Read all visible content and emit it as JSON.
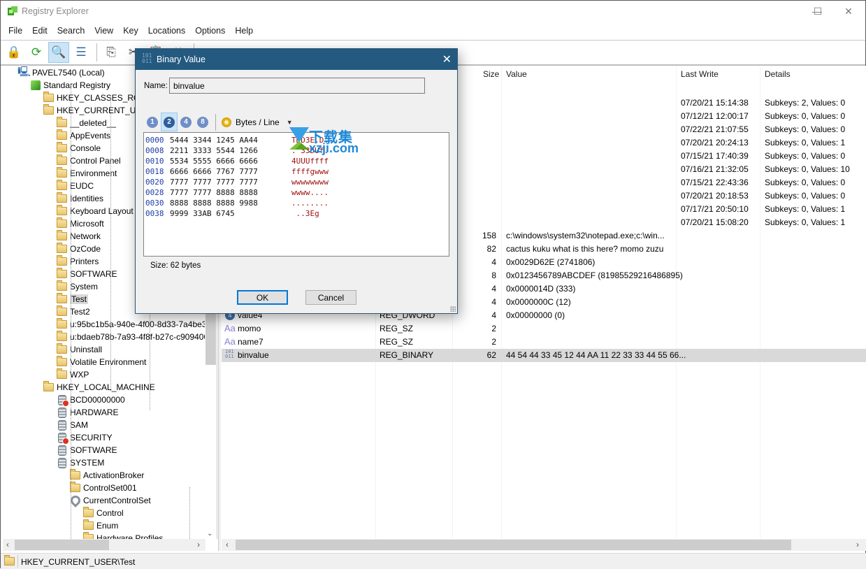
{
  "window": {
    "title": "Registry Explorer",
    "controls": {
      "minimize": "—",
      "maximize": "☐",
      "close": "✕"
    }
  },
  "menu": [
    "File",
    "Edit",
    "Search",
    "View",
    "Key",
    "Locations",
    "Options",
    "Help"
  ],
  "toolbar": {
    "buttons": [
      {
        "icon": "lock-icon",
        "glyph": "🔒"
      },
      {
        "icon": "refresh-icon",
        "glyph": "⟳"
      },
      {
        "icon": "browse-folder-icon",
        "glyph": "🔍",
        "active": true
      },
      {
        "icon": "view-list-icon",
        "glyph": "☰"
      },
      {
        "icon": "copy-icon",
        "glyph": "⎘"
      },
      {
        "icon": "cut-icon",
        "glyph": "✂"
      },
      {
        "icon": "paste-icon",
        "glyph": "📋"
      },
      {
        "icon": "delete-icon",
        "glyph": "✖"
      },
      {
        "icon": "back-icon",
        "glyph": "◀"
      },
      {
        "icon": "forward-icon",
        "glyph": "▶"
      },
      {
        "icon": "registry-icon",
        "glyph": "▦"
      }
    ]
  },
  "tree": {
    "items": [
      {
        "label": "PAVEL7540 (Local)",
        "icon": "computer",
        "level": 0
      },
      {
        "label": "Standard Registry",
        "icon": "registry",
        "level": 1
      },
      {
        "label": "HKEY_CLASSES_ROOT",
        "icon": "folder",
        "level": 2
      },
      {
        "label": "HKEY_CURRENT_USER",
        "icon": "folder",
        "level": 2
      },
      {
        "label": "__deleted__",
        "icon": "folder",
        "level": 3
      },
      {
        "label": "AppEvents",
        "icon": "folder",
        "level": 3
      },
      {
        "label": "Console",
        "icon": "folder",
        "level": 3
      },
      {
        "label": "Control Panel",
        "icon": "folder",
        "level": 3
      },
      {
        "label": "Environment",
        "icon": "folder",
        "level": 3
      },
      {
        "label": "EUDC",
        "icon": "folder",
        "level": 3
      },
      {
        "label": "Identities",
        "icon": "folder",
        "level": 3
      },
      {
        "label": "Keyboard Layout",
        "icon": "folder",
        "level": 3
      },
      {
        "label": "Microsoft",
        "icon": "folder",
        "level": 3
      },
      {
        "label": "Network",
        "icon": "folder",
        "level": 3
      },
      {
        "label": "OzCode",
        "icon": "folder",
        "level": 3
      },
      {
        "label": "Printers",
        "icon": "folder",
        "level": 3
      },
      {
        "label": "SOFTWARE",
        "icon": "folder",
        "level": 3
      },
      {
        "label": "System",
        "icon": "folder",
        "level": 3
      },
      {
        "label": "Test",
        "icon": "folder-open",
        "level": 3,
        "selected": true
      },
      {
        "label": "Test2",
        "icon": "folder",
        "level": 3
      },
      {
        "label": "u:95bc1b5a-940e-4f00-8d33-7a4be3",
        "icon": "folder",
        "level": 3
      },
      {
        "label": "u:bdaeb78b-7a93-4f8f-b27c-c909400",
        "icon": "folder",
        "level": 3
      },
      {
        "label": "Uninstall",
        "icon": "folder",
        "level": 3
      },
      {
        "label": "Volatile Environment",
        "icon": "folder",
        "level": 3
      },
      {
        "label": "WXP",
        "icon": "folder",
        "level": 3
      },
      {
        "label": "HKEY_LOCAL_MACHINE",
        "icon": "folder",
        "level": 2
      },
      {
        "label": "BCD00000000",
        "icon": "hive-denied",
        "level": 3
      },
      {
        "label": "HARDWARE",
        "icon": "hive",
        "level": 3
      },
      {
        "label": "SAM",
        "icon": "hive",
        "level": 3
      },
      {
        "label": "SECURITY",
        "icon": "hive-denied",
        "level": 3
      },
      {
        "label": "SOFTWARE",
        "icon": "hive",
        "level": 3
      },
      {
        "label": "SYSTEM",
        "icon": "hive",
        "level": 3
      },
      {
        "label": "ActivationBroker",
        "icon": "folder",
        "level": 4
      },
      {
        "label": "ControlSet001",
        "icon": "folder",
        "level": 4
      },
      {
        "label": "CurrentControlSet",
        "icon": "link",
        "level": 4
      },
      {
        "label": "Control",
        "icon": "folder",
        "level": 5
      },
      {
        "label": "Enum",
        "icon": "folder",
        "level": 5
      },
      {
        "label": "Hardware Profiles",
        "icon": "folder",
        "level": 5
      }
    ]
  },
  "list": {
    "columns": [
      "Name",
      "Type",
      "Size",
      "Value",
      "Last Write",
      "Details"
    ],
    "key_rows": [
      {
        "last_write": "07/20/21 15:14:38",
        "details": "Subkeys: 2, Values: 0"
      },
      {
        "last_write": "07/12/21 12:00:17",
        "details": "Subkeys: 0, Values: 0"
      },
      {
        "last_write": "07/22/21 21:07:55",
        "details": "Subkeys: 0, Values: 0"
      },
      {
        "last_write": "07/20/21 20:24:13",
        "details": "Subkeys: 0, Values: 1"
      },
      {
        "last_write": "07/15/21 17:40:39",
        "details": "Subkeys: 0, Values: 0"
      },
      {
        "last_write": "07/16/21 21:32:05",
        "details": "Subkeys: 0, Values: 10"
      },
      {
        "last_write": "07/15/21 22:43:36",
        "details": "Subkeys: 0, Values: 0"
      },
      {
        "last_write": "07/20/21 20:18:53",
        "details": "Subkeys: 0, Values: 0"
      },
      {
        "last_write": "07/17/21 20:50:10",
        "details": "Subkeys: 0, Values: 1"
      },
      {
        "last_write": "07/20/21 15:08:20",
        "details": "Subkeys: 0, Values: 1"
      }
    ],
    "value_rows": [
      {
        "name": "",
        "type": "",
        "size": "158",
        "value": "c:\\windows\\system32\\notepad.exe;c:\\win..."
      },
      {
        "name": "",
        "type": "",
        "size": "82",
        "value": "cactus kuku what is this here? momo zuzu"
      },
      {
        "name": "",
        "type": "",
        "size": "4",
        "value": "0x0029D62E (2741806)"
      },
      {
        "name": "",
        "type": "",
        "size": "8",
        "value": "0x0123456789ABCDEF (81985529216486895)"
      },
      {
        "name": "",
        "type": "",
        "size": "4",
        "value": "0x0000014D (333)"
      },
      {
        "name": "",
        "type": "",
        "size": "4",
        "value": "0x0000000C (12)"
      },
      {
        "name": "value4",
        "type": "REG_DWORD",
        "size": "4",
        "value": "0x00000000 (0)",
        "icon": "dword"
      },
      {
        "name": "momo",
        "type": "REG_SZ",
        "size": "2",
        "value": "",
        "icon": "string"
      },
      {
        "name": "name7",
        "type": "REG_SZ",
        "size": "2",
        "value": "",
        "icon": "string"
      },
      {
        "name": "binvalue",
        "type": "REG_BINARY",
        "size": "62",
        "value": "44 54 44 33 45 12 44 AA 11 22 33 33 44 55 66...",
        "icon": "binary",
        "selected": true
      }
    ]
  },
  "statusbar": {
    "path": "HKEY_CURRENT_USER\\Test"
  },
  "dialog": {
    "title": "Binary Value",
    "name_label": "Name:",
    "name_value": "binvalue",
    "width_buttons": [
      "1",
      "2",
      "4",
      "8"
    ],
    "active_width": "2",
    "bytes_per_line_label": "Bytes / Line",
    "hex_rows": [
      {
        "offset": "0000",
        "bytes": "5444 3344 1245 AA44",
        "ascii": "TDD3E.D."
      },
      {
        "offset": "0008",
        "bytes": "2211 3333 5544 1266",
        "ascii": ".\"33DUf."
      },
      {
        "offset": "0010",
        "bytes": "5534 5555 6666 6666",
        "ascii": "4UUUffff"
      },
      {
        "offset": "0018",
        "bytes": "6666 6666 7767 7777",
        "ascii": "ffffgwww"
      },
      {
        "offset": "0020",
        "bytes": "7777 7777 7777 7777",
        "ascii": "wwwwwwww"
      },
      {
        "offset": "0028",
        "bytes": "7777 7777 8888 8888",
        "ascii": "wwww...."
      },
      {
        "offset": "0030",
        "bytes": "8888 8888 8888 9988",
        "ascii": "........"
      },
      {
        "offset": "0038",
        "bytes": "9999 33AB 6745",
        "ascii": " ..3Eg"
      }
    ],
    "size_text": "Size: 62 bytes",
    "ok_label": "OK",
    "cancel_label": "Cancel"
  },
  "watermark": {
    "line1": "下载集",
    "line2": "xzji.com"
  }
}
